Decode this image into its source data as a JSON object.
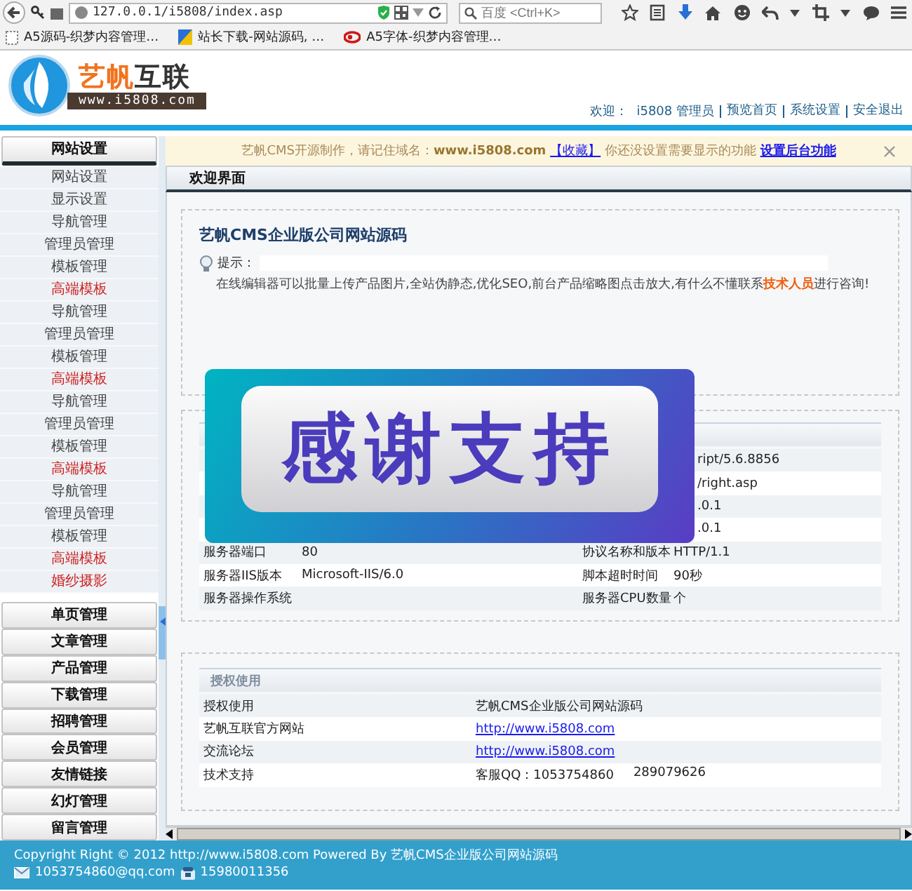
{
  "browser": {
    "address": "127.0.0.1/i5808/index.asp",
    "search_placeholder": "百度 <Ctrl+K>"
  },
  "bookmarks": [
    {
      "label": "A5源码-织梦内容管理…",
      "kind": "blank"
    },
    {
      "label": "站长下载-网站源码, …",
      "kind": "tile"
    },
    {
      "label": "A5字体-织梦内容管理…",
      "kind": "logo"
    }
  ],
  "header": {
    "logo_name_1": "艺帆",
    "logo_name_2": "互联",
    "logo_url": "www.i5808.com",
    "welcome": "欢迎：",
    "user": "i5808 管理员",
    "links": [
      "预览首页",
      "系统设置",
      "安全退出"
    ]
  },
  "sidebar": {
    "groups": [
      {
        "label": "网站设置",
        "expanded": true,
        "children": [
          {
            "label": "网站设置",
            "color": "#444444"
          },
          {
            "label": "显示设置",
            "color": "#444444"
          },
          {
            "label": "导航管理",
            "color": "#444444"
          },
          {
            "label": "管理员管理",
            "color": "#444444"
          },
          {
            "label": "模板管理",
            "color": "#444444"
          },
          {
            "label": "高端模板",
            "color": "#cc2222"
          },
          {
            "label": "导航管理",
            "color": "#444444"
          },
          {
            "label": "管理员管理",
            "color": "#444444"
          },
          {
            "label": "模板管理",
            "color": "#444444"
          },
          {
            "label": "高端模板",
            "color": "#cc2222"
          },
          {
            "label": "导航管理",
            "color": "#444444"
          },
          {
            "label": "管理员管理",
            "color": "#444444"
          },
          {
            "label": "模板管理",
            "color": "#444444"
          },
          {
            "label": "高端模板",
            "color": "#cc2222"
          },
          {
            "label": "导航管理",
            "color": "#444444"
          },
          {
            "label": "管理员管理",
            "color": "#444444"
          },
          {
            "label": "模板管理",
            "color": "#444444"
          },
          {
            "label": "高端模板",
            "color": "#cc2222"
          },
          {
            "label": "婚纱摄影",
            "color": "#cc2222"
          }
        ]
      },
      {
        "label": "单页管理",
        "expanded": false
      },
      {
        "label": "文章管理",
        "expanded": false
      },
      {
        "label": "产品管理",
        "expanded": false
      },
      {
        "label": "下载管理",
        "expanded": false
      },
      {
        "label": "招聘管理",
        "expanded": false
      },
      {
        "label": "会员管理",
        "expanded": false
      },
      {
        "label": "友情链接",
        "expanded": false
      },
      {
        "label": "幻灯管理",
        "expanded": false
      },
      {
        "label": "留言管理",
        "expanded": false
      }
    ]
  },
  "notice": {
    "text": "艺帆CMS开源制作，请记住域名：",
    "domain": "www.i5808.com",
    "bookmark_link": "【收藏】",
    "text_2": "你还没设置需要显示的功能",
    "settings_link": "设置后台功能"
  },
  "tab": {
    "label": "欢迎界面"
  },
  "intro": {
    "title": "艺帆CMS企业版公司网站源码",
    "tip_label": "提示：",
    "description": "在线编辑器可以批量上传产品图片,全站伪静态,优化SEO,前台产品缩略图点击放大,有什么不懂联系**技术人员**进行咨询!"
  },
  "server_info": {
    "rows": [
      {
        "value_2": "ript/5.6.8856"
      },
      {
        "value_2": "/right.asp"
      },
      {
        "value_2": ".0.1"
      },
      {
        "value_2": ".0.1"
      },
      {
        "label": "服务器端口",
        "value": "80",
        "label_2": "协议名称和版本",
        "value_2": "HTTP/1.1"
      },
      {
        "label": "服务器IIS版本",
        "value": "Microsoft-IIS/6.0",
        "label_2": "脚本超时时间",
        "value_2": "90秒"
      },
      {
        "label": "服务器操作系统",
        "label_2": "服务器CPU数量",
        "value_2": "个"
      }
    ]
  },
  "license": {
    "title": "授权使用",
    "rows": [
      {
        "label": "授权使用",
        "value": "艺帆CMS企业版公司网站源码",
        "kind": "text"
      },
      {
        "label": "艺帆互联官方网站",
        "value": "http://www.i5808.com",
        "kind": "link"
      },
      {
        "label": "交流论坛",
        "value": "http://www.i5808.com",
        "kind": "link"
      },
      {
        "label": "技术支持",
        "value": "客服QQ：1053754860",
        "value_2": "289079626",
        "kind": "text"
      }
    ]
  },
  "popup": {
    "text": "感谢支持"
  },
  "footer": {
    "copyright": "Copyright Right © 2012 http://www.i5808.com Powered By 艺帆CMS企业版公司网站源码",
    "email": "1053754860@qq.com",
    "phone": "15980011356"
  }
}
